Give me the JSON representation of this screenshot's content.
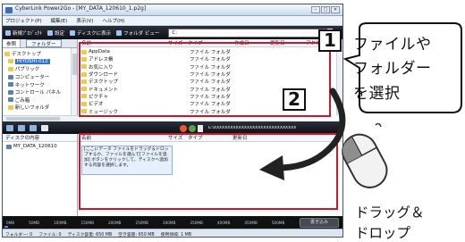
{
  "window": {
    "title": "CyberLink Power2Go - [MY_DATA_120610_1.p2g]",
    "controls": [
      "–",
      "□",
      "×"
    ],
    "brand": "Po"
  },
  "menu": [
    "プロジェクト(P)",
    "編集(E)",
    "表示(V)",
    "ヘルプ(H)"
  ],
  "toolbar": {
    "items": [
      "新規ﾌﾟﾛｼﾞｪｸﾄ",
      "設定",
      "ディスクに表示",
      "フォルダ ビュー"
    ],
    "path_value": "C:"
  },
  "left_pane": {
    "tabs": [
      "参照",
      "フォルダー"
    ],
    "tree": [
      {
        "label": "デスクトップ",
        "icon": "folder"
      },
      {
        "label": "HIYOSHI-012",
        "icon": "folder",
        "selected": true
      },
      {
        "label": "パブリック",
        "icon": "folder"
      },
      {
        "label": "コンピューター",
        "icon": "computer"
      },
      {
        "label": "ネットワーク",
        "icon": "network"
      },
      {
        "label": "コントロール パネル",
        "icon": "control-panel"
      },
      {
        "label": "ごみ箱",
        "icon": "recycle-bin"
      },
      {
        "label": "新しいフォルダ",
        "icon": "folder"
      }
    ]
  },
  "right_pane": {
    "columns": [
      "名前",
      "サイズ",
      "タイプ",
      "作成日",
      "更新日",
      "アクセ"
    ],
    "rows": [
      {
        "name": "AppData",
        "type": "ファイル フォルダ"
      },
      {
        "name": "アドレス帳",
        "type": "ファイル フォルダ"
      },
      {
        "name": "お気に入り",
        "type": "ファイル フォルダ"
      },
      {
        "name": "ダウンロード",
        "type": "ファイル フォルダ"
      },
      {
        "name": "デスクトップ",
        "type": "ファイル フォルダ"
      },
      {
        "name": "ドキュメント",
        "type": "ファイル フォルダ"
      },
      {
        "name": "ピクチャ",
        "type": "ファイル フォルダ"
      },
      {
        "name": "ビデオ",
        "type": "ファイル フォルダ"
      },
      {
        "name": "ミュージック",
        "type": "ファイル フォルダ"
      }
    ]
  },
  "disc_bar": {
    "path": "E:\\XXXXXXXXXXXXXXXXXXXXXXXXXXXXXX"
  },
  "disc_pane": {
    "left_header": "ディスクの内容",
    "left_item": "MY_DATA_120610",
    "columns": [
      "名前",
      "サイズ",
      "タイプ",
      "更新日"
    ],
    "hint": "[ここにデータ ファイルをドラッグ＆ドロップするか、ファイルを選んで[ファイルを追加] ボタンをクリックして、ディスクへ追加する内容を選択します。"
  },
  "capacity": {
    "labels": [
      "0MB",
      "50MB",
      "100MB",
      "150MB",
      "200MB",
      "250MB",
      "300MB",
      "350MB",
      "400MB",
      "450MB",
      "500MB",
      "550MB",
      "600MB",
      "650MB"
    ],
    "fill": 0.01,
    "write_button": "書き込み"
  },
  "status": [
    "フォルダー: 0",
    "ファイル: 0",
    "ディスク容量: 650 MB",
    "空き容量: 650 MB",
    "使用領域: 1 MB"
  ],
  "callouts": {
    "step1": "1",
    "step2": "2",
    "bubble_lines": [
      "ファイルや",
      "フォルダー",
      "を選択"
    ],
    "drag_lines": [
      "ドラッグ＆",
      "ドロップ"
    ]
  }
}
